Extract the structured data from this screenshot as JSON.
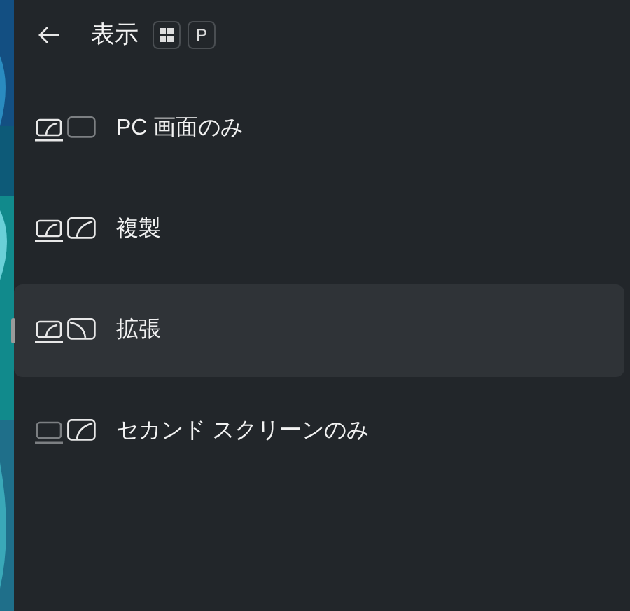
{
  "header": {
    "title": "表示",
    "shortcut": [
      {
        "kind": "logo"
      },
      {
        "kind": "key",
        "label": "P"
      }
    ]
  },
  "modes": [
    {
      "kind": "pc_only",
      "label": "PC 画面のみ",
      "selected": false
    },
    {
      "kind": "duplicate",
      "label": "複製",
      "selected": false
    },
    {
      "kind": "extend",
      "label": "拡張",
      "selected": true
    },
    {
      "kind": "second_only",
      "label": "セカンド スクリーンのみ",
      "selected": false
    }
  ]
}
